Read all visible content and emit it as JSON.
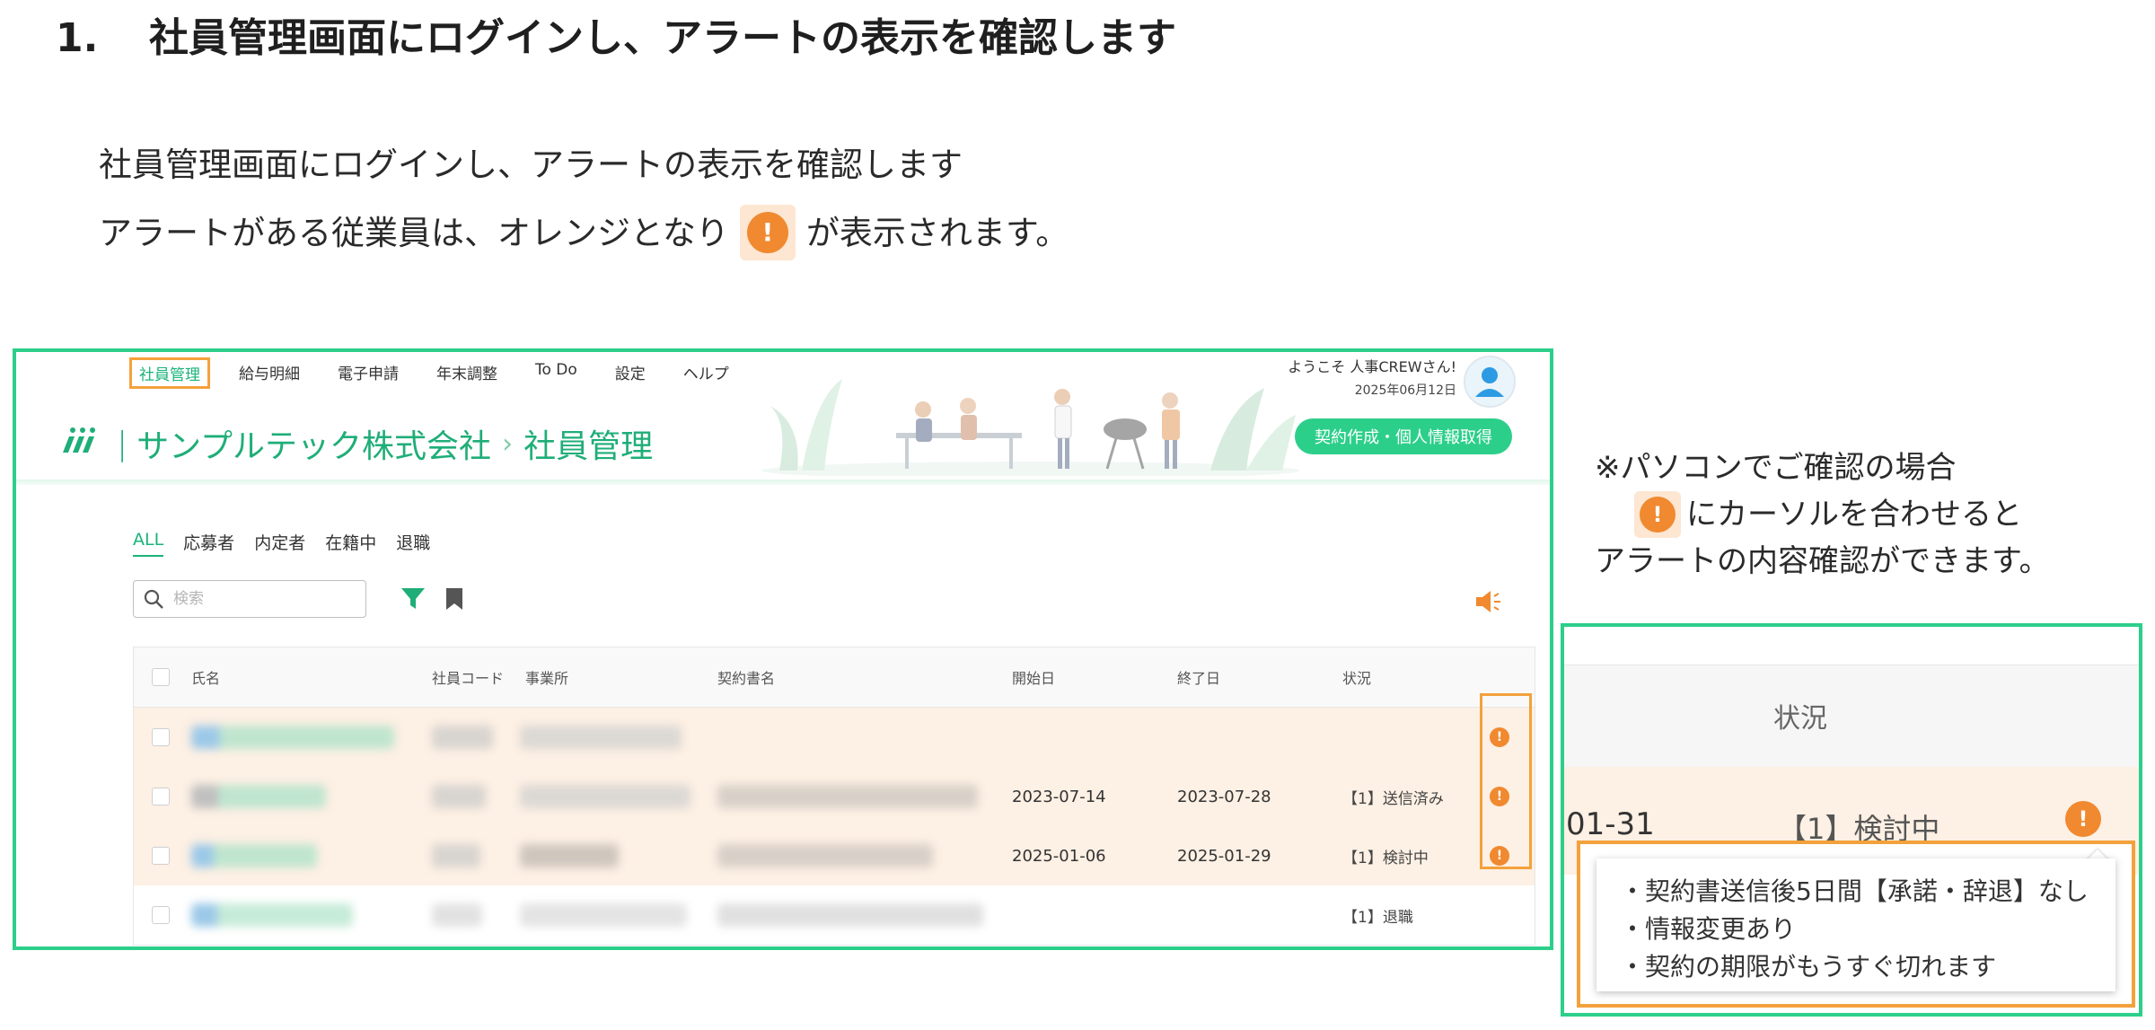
{
  "heading": {
    "number": "1.",
    "text": "社員管理画面にログインし、アラートの表示を確認します"
  },
  "intro": {
    "line1": "社員管理画面にログインし、アラートの表示を確認します",
    "line2_before": "アラートがある従業員は、オレンジとなり",
    "line2_after": "が表示されます。"
  },
  "app": {
    "nav": [
      "社員管理",
      "給与明細",
      "電子申請",
      "年末調整",
      "To Do",
      "設定",
      "ヘルプ"
    ],
    "welcome": "ようこそ 人事CREWさん!",
    "date": "2025年06月12日",
    "contract_button": "契約作成・個人情報取得",
    "company": "サンプルテック株式会社",
    "page": "社員管理",
    "tabs": [
      "ALL",
      "応募者",
      "内定者",
      "在籍中",
      "退職"
    ],
    "search_placeholder": "検索",
    "columns": {
      "name": "氏名",
      "code": "社員コード",
      "office": "事業所",
      "contract": "契約書名",
      "start": "開始日",
      "end": "終了日",
      "status": "状況"
    },
    "rows": [
      {
        "start": "",
        "end": "",
        "status": "",
        "alert": true
      },
      {
        "start": "2023-07-14",
        "end": "2023-07-28",
        "status": "【1】送信済み",
        "alert": true
      },
      {
        "start": "2025-01-06",
        "end": "2025-01-29",
        "status": "【1】検討中",
        "alert": true
      },
      {
        "start": "",
        "end": "",
        "status": "【1】退職",
        "alert": false
      }
    ]
  },
  "note": {
    "line1": "※パソコンでご確認の場合",
    "line2": "にカーソルを合わせると",
    "line3": "アラートの内容確認ができます。"
  },
  "zoom": {
    "header": "状況",
    "date_fragment": "01-31",
    "status": "【1】検討中",
    "tooltip": [
      "・契約書送信後5日間【承諾・辞退】なし",
      "・情報変更あり",
      "・契約の期限がもうすぐ切れます"
    ]
  },
  "alert_glyph": "!",
  "colors": {
    "accent": "#2ccf8a",
    "alert": "#f0892f",
    "highlight": "#f3a13c",
    "alert_row": "#fdf0e4"
  }
}
